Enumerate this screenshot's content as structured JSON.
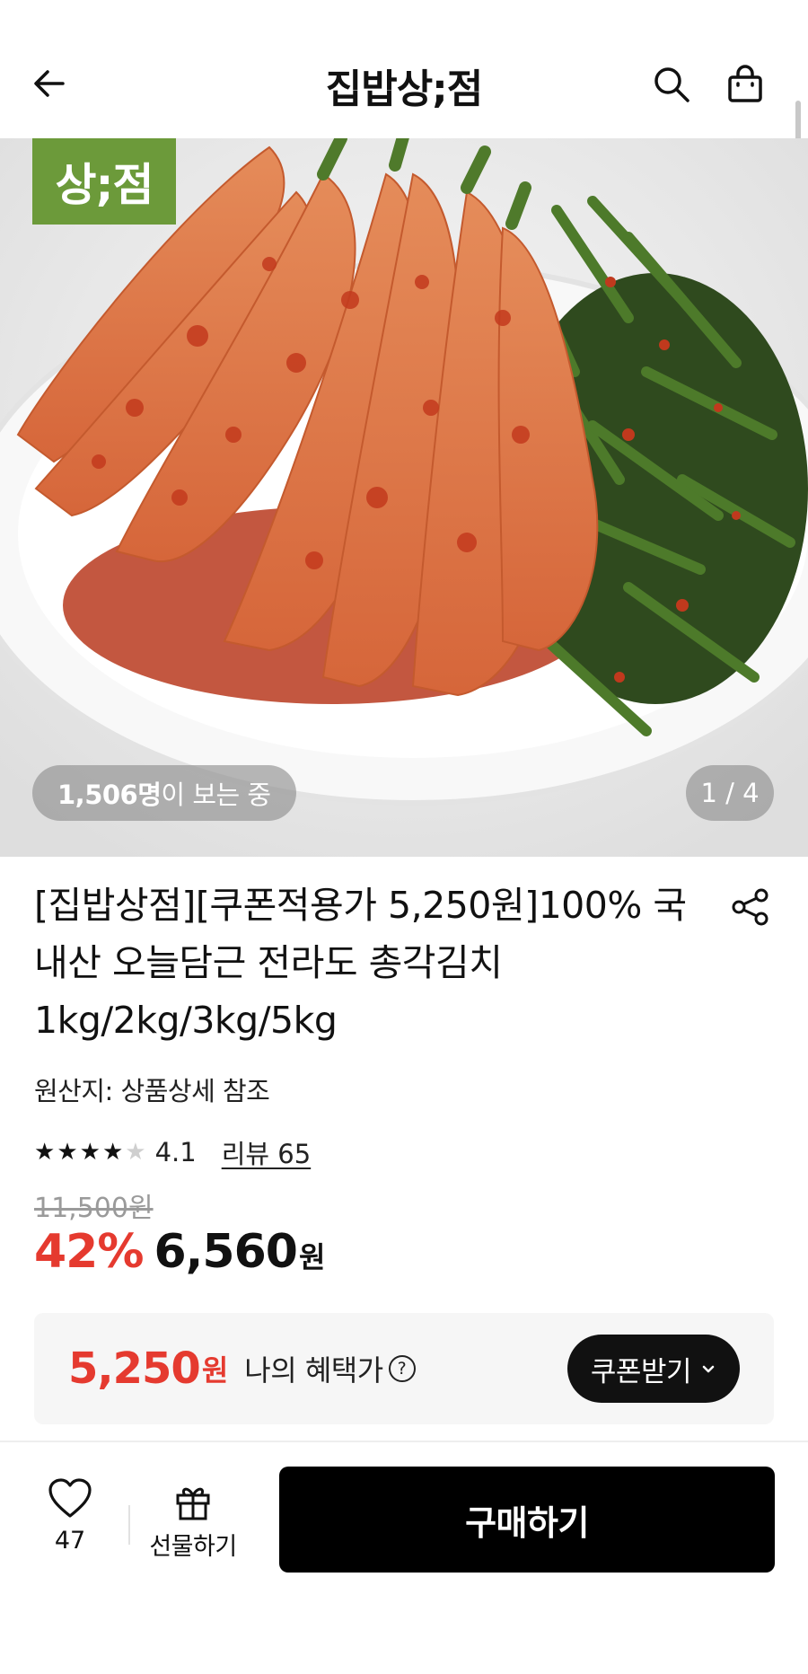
{
  "header": {
    "title": "집밥상;점",
    "back_icon": "back-arrow-icon",
    "search_icon": "search-icon",
    "cart_icon": "shopping-bag-icon"
  },
  "hero": {
    "logo_text": "상;점",
    "viewers_count": "1,506명",
    "viewers_suffix": "이 보는 중",
    "page_indicator": "1 / 4"
  },
  "product": {
    "title": "[집밥상점][쿠폰적용가 5,250원]100% 국내산 오늘담근 전라도 총각김치 1kg/2kg/3kg/5kg",
    "origin": "원산지: 상품상세 참조",
    "rating": "4.1",
    "rating_stars": 4,
    "review_label": "리뷰 65",
    "original_price": "11,500원",
    "discount": "42%",
    "price": "6,560",
    "currency": "원"
  },
  "benefit": {
    "price": "5,250",
    "currency": "원",
    "label": "나의 혜택가",
    "help_icon": "?",
    "coupon_button": "쿠폰받기"
  },
  "bottom_bar": {
    "like_count": "47",
    "gift_label": "선물하기",
    "buy_label": "구매하기"
  },
  "colors": {
    "accent_red": "#e53a2f",
    "logo_green": "#6c9a3a",
    "primary_black": "#000000"
  }
}
